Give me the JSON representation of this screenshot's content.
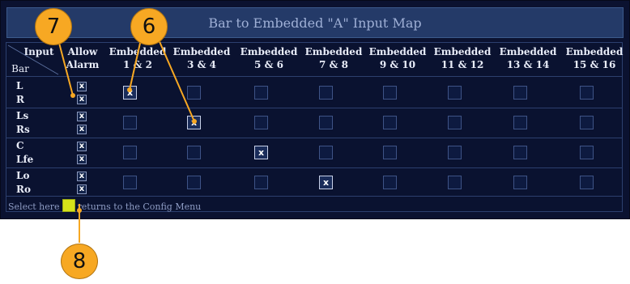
{
  "title": "Bar to Embedded \"A\" Input Map",
  "header": {
    "input_label": "Input",
    "bar_label": "Bar",
    "allow_line1": "Allow",
    "allow_line2": "Alarm",
    "columns": [
      {
        "line1": "Embedded",
        "line2": "1 & 2"
      },
      {
        "line1": "Embedded",
        "line2": "3 & 4"
      },
      {
        "line1": "Embedded",
        "line2": "5 & 6"
      },
      {
        "line1": "Embedded",
        "line2": "7 & 8"
      },
      {
        "line1": "Embedded",
        "line2": "9 & 10"
      },
      {
        "line1": "Embedded",
        "line2": "11 & 12"
      },
      {
        "line1": "Embedded",
        "line2": "13 & 14"
      },
      {
        "line1": "Embedded",
        "line2": "15 & 16"
      }
    ]
  },
  "rows": [
    {
      "top": "L",
      "bottom": "R",
      "alarm_mark": "x",
      "selected_column": 1
    },
    {
      "top": "Ls",
      "bottom": "Rs",
      "alarm_mark": "x",
      "selected_column": 2
    },
    {
      "top": "C",
      "bottom": "Lfe",
      "alarm_mark": "x",
      "selected_column": 3
    },
    {
      "top": "Lo",
      "bottom": "Ro",
      "alarm_mark": "x",
      "selected_column": 4
    }
  ],
  "check_mark": "x",
  "footer": {
    "before": "Select here",
    "after": "returns to the Config Menu"
  },
  "callouts": {
    "c7": "7",
    "c6": "6",
    "c8": "8"
  },
  "colors": {
    "callout": "#f7a823",
    "select_button": "#d6e21a",
    "panel_bg": "#0b1230"
  }
}
